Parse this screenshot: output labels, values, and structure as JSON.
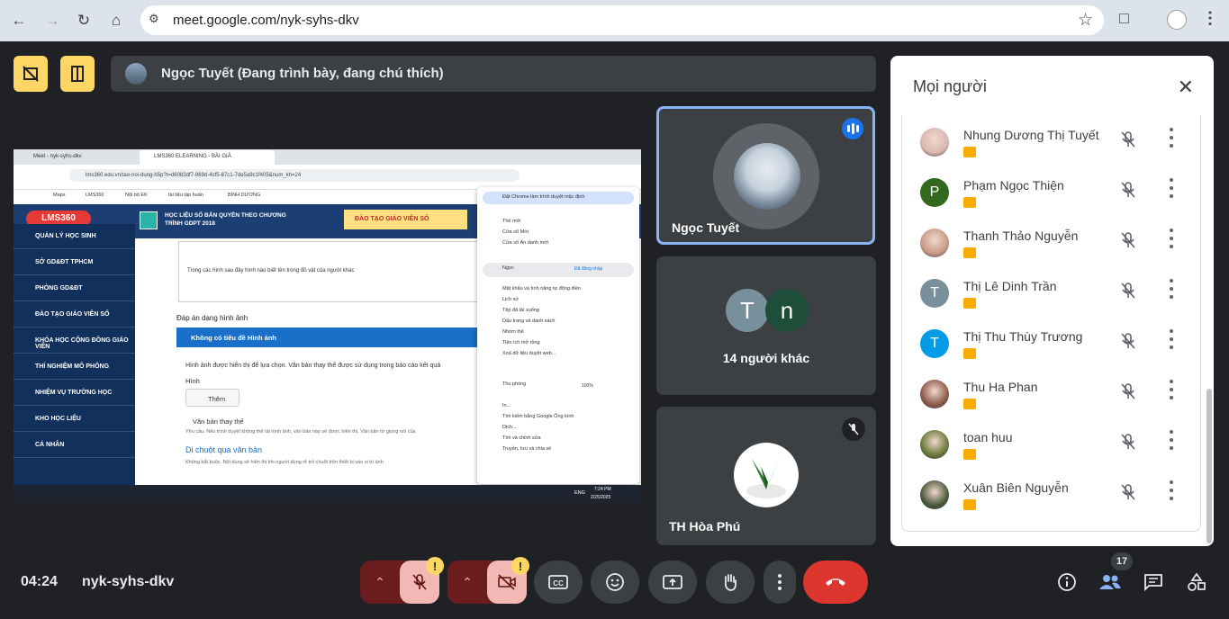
{
  "browser": {
    "url": "meet.google.com/nyk-syhs-dkv"
  },
  "presentation_bar": {
    "title": "Ngọc Tuyết (Đang trình bày, đang chú thích)"
  },
  "shared_screen": {
    "tab1": "Meet - nyk-syhs-dkv",
    "tab2": "LMS360 ELEARNING - BÀI GIẢ",
    "url": "lms360.edu.vn/tao-noi-dung-h5p?t=d6083df7-969d-4cf5-87c1-7de5a9c1f405&num_kh=24",
    "bookmarks": [
      "Maps",
      "LMS360",
      "Nội bộ EK",
      "tài liệu tập huấn",
      "BÌNH DƯƠNG"
    ],
    "logo": "LMS360",
    "banner": "HỌC LIỆU SỐ BẢN QUYỀN THEO CHƯƠNG TRÌNH GDPT 2018",
    "promo": "ĐÀO TẠO GIÁO VIÊN SỐ",
    "sidebar": [
      "QUẢN LÝ HỌC SINH",
      "SỞ GD&ĐT TPHCM",
      "PHÒNG GD&ĐT",
      "ĐÀO TẠO GIÁO VIÊN SỐ",
      "KHÓA HỌC CỘNG ĐỒNG GIÁO VIÊN",
      "THÍ NGHIỆM MÔ PHỎNG",
      "NHIỆM VỤ TRƯỜNG HỌC",
      "KHO HỌC LIỆU",
      "CÁ NHÂN"
    ],
    "editor_text": "Trong các hình sau đây hình nào biết tên trong đồ vật của người khác",
    "answer_label": "Đáp án dạng hình ảnh",
    "no_title": "Không có tiêu đề Hình ảnh",
    "image_hint": "Hình ảnh được hiển thị để lựa chọn. Văn bản thay thế được sử dụng trong báo cáo kết quả",
    "image_label": "Hình",
    "add_button": "Thêm",
    "alt_label": "Văn bản thay thế",
    "alt_hint": "Yêu cầu. Nếu trình duyệt không thể tải hình ảnh, văn bản này sẽ được hiển thị. Văn bản từ giọng nói của",
    "hover_label": "Di chuột qua văn bản",
    "hover_hint": "Không bắt buộc. Nội dung sẽ hiển thị khi người dùng rê trỏ chuột trên thiết bị vào vị trí ảnh",
    "menu": [
      "Đặt Chrome làm trình duyệt mặc định",
      "Thẻ mới",
      "Cửa sổ Mới",
      "Cửa sổ Ẩn danh mới",
      "Ngọc",
      "Mật khẩu và tính năng tự động điền",
      "Lịch sử",
      "Tệp đã tải xuống",
      "Dấu trang và danh sách",
      "Nhóm thẻ",
      "Tiện ích mở rộng",
      "Xoá dữ liệu duyệt web...",
      "Thu phóng",
      "In...",
      "Tìm kiếm bằng Google Ống kính",
      "Dịch...",
      "Tìm và chỉnh sửa",
      "Truyền, lưu và chia sẻ"
    ],
    "menu_signed": "Đã đăng nhập",
    "zoom": "100%",
    "taskbar_time": "7:24 PM",
    "taskbar_date": "2/25/2025",
    "taskbar_lang": "ENG"
  },
  "tiles": [
    {
      "name": "Ngọc Tuyết"
    },
    {
      "name": "14 người khác",
      "initials": [
        "T",
        "n"
      ]
    },
    {
      "name": "TH Hòa Phú"
    }
  ],
  "panel": {
    "title": "Mọi người",
    "people": [
      {
        "name": "Nhung Dương Thị Tuyết",
        "avatar": "photo",
        "color": "#d9b8b0"
      },
      {
        "name": "Phạm Ngọc Thiện",
        "avatar": "P",
        "color": "#33691e"
      },
      {
        "name": "Thanh Thảo Nguyễn",
        "avatar": "photo",
        "color": "#c89a86"
      },
      {
        "name": "Thị Lê Dinh Trần",
        "avatar": "T",
        "color": "#78909c"
      },
      {
        "name": "Thị Thu Thùy Trương",
        "avatar": "T",
        "color": "#039be5"
      },
      {
        "name": "Thu Ha Phan",
        "avatar": "photo",
        "color": "#8d5a4a"
      },
      {
        "name": "toan huu",
        "avatar": "photo",
        "color": "#6b7a3a"
      },
      {
        "name": "Xuân Biên Nguyễn",
        "avatar": "photo",
        "color": "#4a5a3a"
      }
    ]
  },
  "bottom": {
    "time": "04:24",
    "meeting_code": "nyk-syhs-dkv",
    "people_count": "17",
    "warn": "!"
  }
}
